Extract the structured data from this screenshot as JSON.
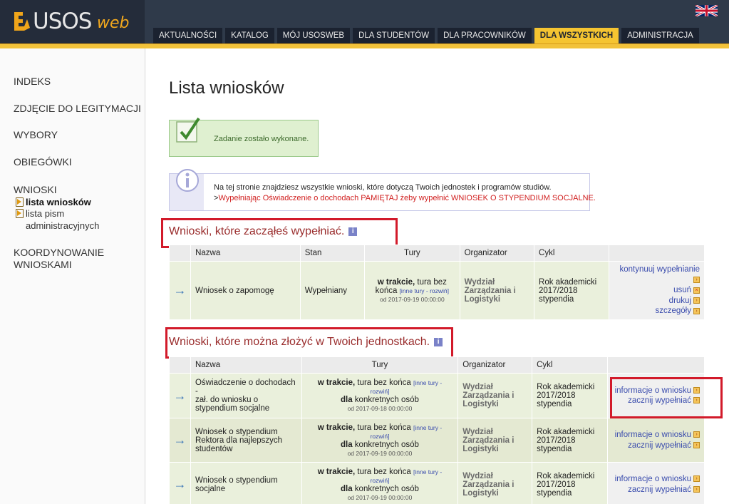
{
  "brand": {
    "name": "USOS",
    "suffix": "web"
  },
  "nav": {
    "tabs": [
      "AKTUALNOŚCI",
      "KATALOG",
      "MÓJ USOSWEB",
      "DLA STUDENTÓW",
      "DLA PRACOWNIKÓW",
      "DLA WSZYSTKICH",
      "ADMINISTRACJA"
    ],
    "active": "DLA WSZYSTKICH"
  },
  "sidebar": {
    "items": [
      "INDEKS",
      "ZDJĘCIE DO LEGITYMACJI",
      "WYBORY",
      "OBIEGÓWKI",
      "WNIOSKI"
    ],
    "sub_items": [
      "lista wniosków",
      "lista pism",
      "administracyjnych"
    ],
    "coord_line1": "KOORDYNOWANIE",
    "coord_line2": "WNIOSKAMI"
  },
  "page": {
    "title": "Lista wniosków",
    "success_message": "Zadanie zostało wykonane.",
    "info_line1": "Na tej stronie znajdziesz wszystkie wnioski, które dotyczą Twoich jednostek i programów studiów.",
    "info_line2_prefix": ">",
    "info_line2": "Wypełniając Oświadczenie o dochodach PAMIĘTAJ żeby wypełnić WNIOSEK O STYPENDIUM SOCJALNE."
  },
  "section1": {
    "title": "Wnioski, które zacząłeś wypełniać.",
    "headers": [
      "Nazwa",
      "Stan",
      "Tury",
      "Organizator",
      "Cykl"
    ],
    "row": {
      "name": "Wniosek o zapomogę",
      "state": "Wypełniany",
      "tury_bold": "w trakcie,",
      "tury_rest": "tura bez",
      "tury_line2": "końca",
      "tury_links": "[inne tury - rozwiń]",
      "date": "od 2017-09-19 00:00:00",
      "org_lines": [
        "Wydział",
        "Zarządzania i",
        "Logistyki"
      ],
      "cycle_lines": [
        "Rok akademicki",
        "2017/2018",
        "stypendia"
      ],
      "actions": [
        "kontynuuj wypełnianie",
        "usuń",
        "drukuj",
        "szczegóły"
      ]
    }
  },
  "section2": {
    "title": "Wnioski, które można złożyć w Twoich jednostkach.",
    "headers": [
      "Nazwa",
      "Tury",
      "Organizator",
      "Cykl"
    ],
    "tury_bold": "w trakcie,",
    "tury_rest": "tura bez końca",
    "tury_link1": "[inne tury -",
    "tury_link2": "rozwiń]",
    "for_bold": "dla",
    "for_rest": "konkretnych osób",
    "org_lines": [
      "Wydział",
      "Zarządzania i",
      "Logistyki"
    ],
    "cycle_lines": [
      "Rok akademicki",
      "2017/2018",
      "stypendia"
    ],
    "actions": [
      "informacje o wniosku",
      "zacznij wypełniać"
    ],
    "rows": [
      {
        "name_lines": [
          "Oświadczenie o dochodach -",
          "zał. do wniosku o",
          "stypendium socjalne"
        ],
        "date": "od 2017-09-18 00:00:00"
      },
      {
        "name_lines": [
          "Wniosek o stypendium",
          "Rektora dla najlepszych",
          "studentów"
        ],
        "date": "od 2017-09-19 00:00:00"
      },
      {
        "name_lines": [
          "Wniosek o stypendium",
          "socjalne"
        ],
        "date": "od 2017-09-19 00:00:00"
      }
    ]
  },
  "colors": {
    "header": "#2f3a4a",
    "accent": "#f5c431",
    "highlight": "#d21a2a"
  }
}
